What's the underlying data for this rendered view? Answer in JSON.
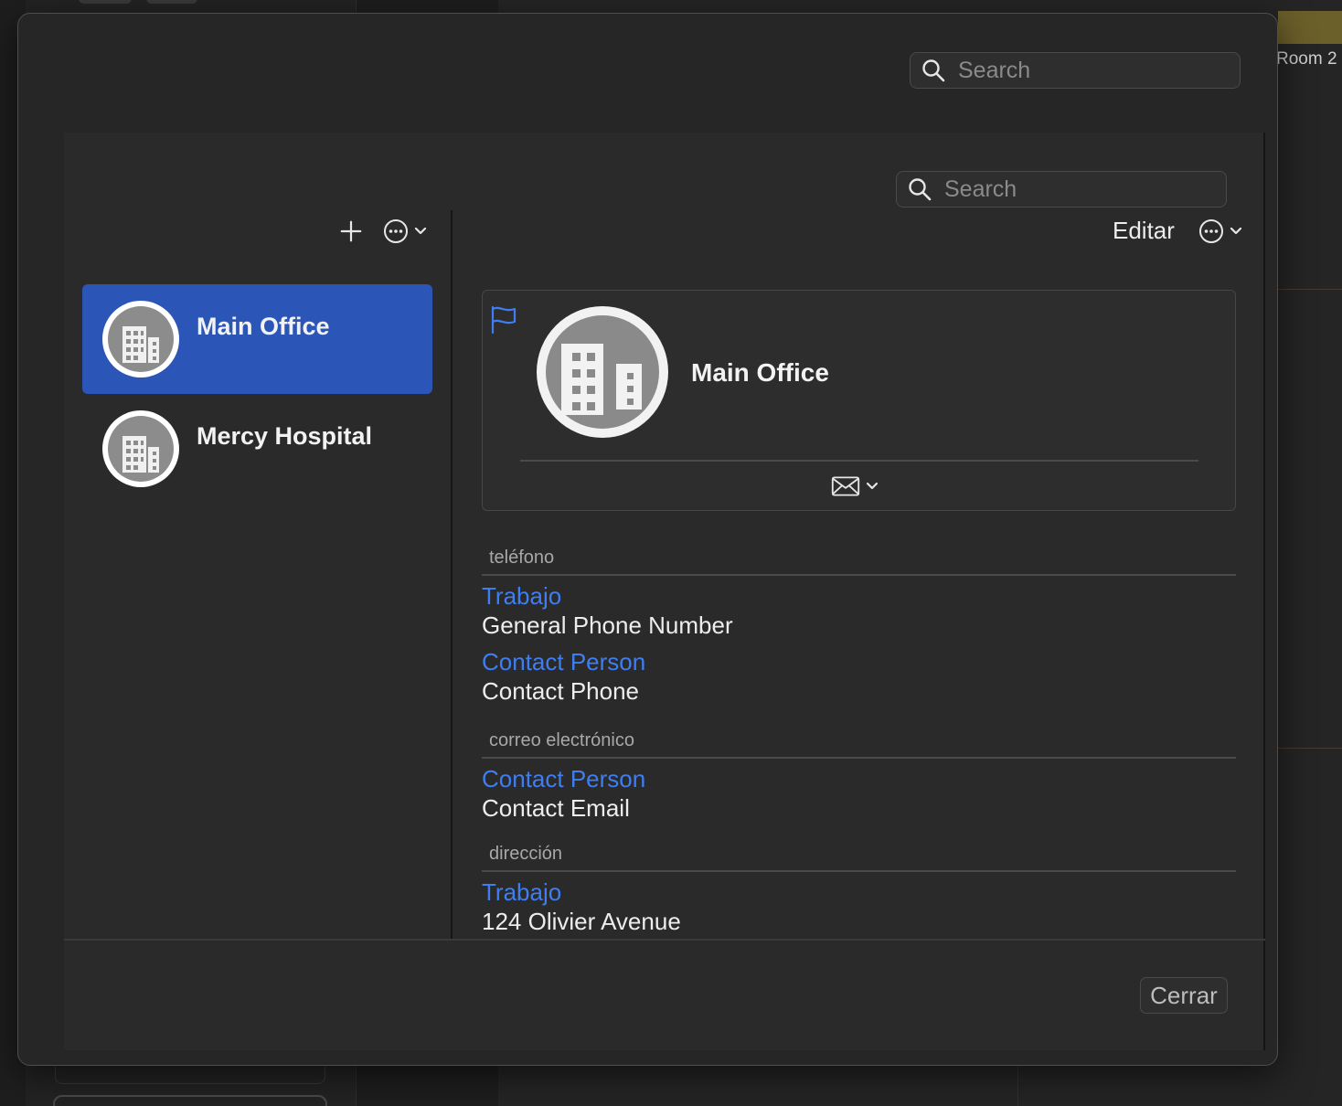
{
  "background": {
    "room_label": "Room 2"
  },
  "outer_search": {
    "placeholder": "Search"
  },
  "inner_search": {
    "placeholder": "Search"
  },
  "left_toolbar": {
    "add_icon": "plus-icon",
    "more_icon": "ellipsis-circle-icon"
  },
  "contacts": [
    {
      "name": "Main Office",
      "selected": true,
      "icon": "building-icon"
    },
    {
      "name": "Mercy Hospital",
      "selected": false,
      "icon": "building-icon"
    }
  ],
  "detail_toolbar": {
    "edit_label": "Editar",
    "more_icon": "ellipsis-circle-icon"
  },
  "card": {
    "name": "Main Office",
    "flag_icon": "flag-icon",
    "mail_icon": "envelope-icon"
  },
  "sections": {
    "phone": {
      "title": "teléfono",
      "entries": [
        {
          "label": "Trabajo",
          "value": "General Phone Number"
        },
        {
          "label": "Contact Person",
          "value": "Contact Phone"
        }
      ]
    },
    "email": {
      "title": "correo electrónico",
      "entries": [
        {
          "label": "Contact Person",
          "value": "Contact Email"
        }
      ]
    },
    "address": {
      "title": "dirección",
      "entries": [
        {
          "label": "Trabajo",
          "value": "124 Olivier Avenue"
        }
      ]
    }
  },
  "footer": {
    "close_label": "Cerrar"
  },
  "colors": {
    "accent": "#3f7ef2",
    "selection": "#2b55b7",
    "panel": "#2a2a2a"
  }
}
